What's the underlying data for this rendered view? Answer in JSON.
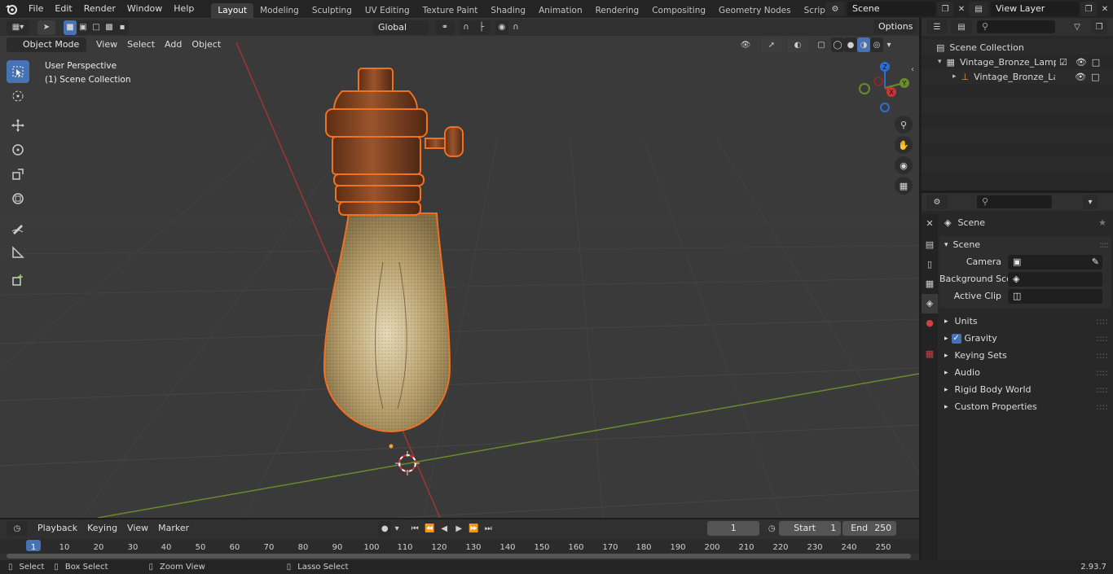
{
  "app": {
    "logo": "blender-logo-icon",
    "version": "2.93.7"
  },
  "menu": [
    "File",
    "Edit",
    "Render",
    "Window",
    "Help"
  ],
  "workspaces": [
    "Layout",
    "Modeling",
    "Sculpting",
    "UV Editing",
    "Texture Paint",
    "Shading",
    "Animation",
    "Rendering",
    "Compositing",
    "Geometry Nodes",
    "Scripting"
  ],
  "active_workspace": "Layout",
  "scene_field": {
    "value": "Scene"
  },
  "view_layer_field": {
    "value": "View Layer"
  },
  "viewport_header": {
    "mode": "Object Mode",
    "menus": [
      "View",
      "Select",
      "Add",
      "Object"
    ],
    "transform_orientation": "Global",
    "options_label": "Options"
  },
  "viewport": {
    "overlay_title": "User Perspective",
    "overlay_collection": "(1) Scene Collection",
    "gizmo_axes": [
      "X",
      "Y",
      "Z"
    ]
  },
  "outliner": {
    "search_placeholder": "",
    "root": "Scene Collection",
    "items": [
      {
        "name": "Vintage_Bronze_Lamp_Holde",
        "level": 1
      },
      {
        "name": "Vintage_Bronze_Lamp_H",
        "level": 2
      }
    ]
  },
  "properties": {
    "context_label": "Scene",
    "section_title": "Scene",
    "fields": [
      {
        "label": "Camera",
        "value": ""
      },
      {
        "label": "Background Scene",
        "value": ""
      },
      {
        "label": "Active Clip",
        "value": ""
      }
    ],
    "panels": [
      "Units",
      "Gravity",
      "Keying Sets",
      "Audio",
      "Rigid Body World",
      "Custom Properties"
    ],
    "gravity_checked": true
  },
  "timeline": {
    "menus": [
      "Playback",
      "Keying",
      "View",
      "Marker"
    ],
    "current_frame": "1",
    "start_label": "Start",
    "start_value": "1",
    "end_label": "End",
    "end_value": "250",
    "ticks": [
      "1",
      "10",
      "20",
      "30",
      "40",
      "50",
      "60",
      "70",
      "80",
      "90",
      "100",
      "110",
      "120",
      "130",
      "140",
      "150",
      "160",
      "170",
      "180",
      "190",
      "200",
      "210",
      "220",
      "230",
      "240",
      "250"
    ]
  },
  "statusbar": {
    "items": [
      "Select",
      "Box Select",
      "Zoom View",
      "Lasso Select"
    ]
  },
  "colors": {
    "accent": "#4772b3",
    "selection_outline": "#f0711f",
    "x_axis": "#a03535",
    "y_axis": "#6a8b2a",
    "z_axis": "#2b6fd0",
    "bronze": "#8a4a26"
  }
}
